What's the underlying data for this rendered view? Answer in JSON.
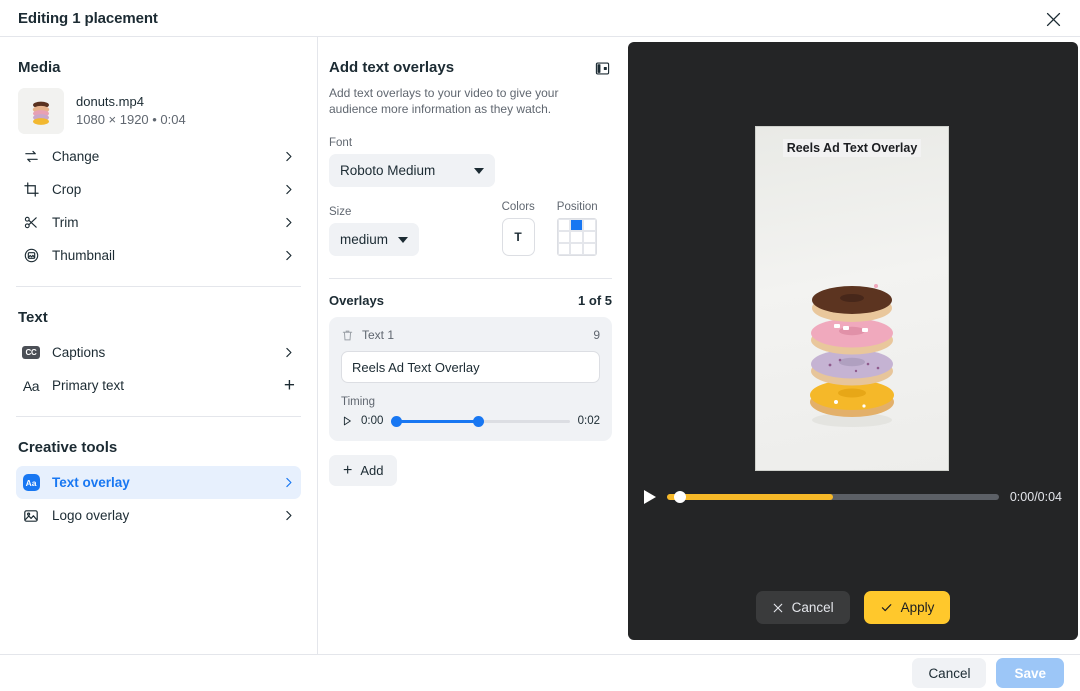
{
  "window": {
    "title": "Editing 1 placement",
    "close_icon": "close-icon"
  },
  "sidebar": {
    "sections": [
      {
        "title": "Media"
      },
      {
        "title": "Text"
      },
      {
        "title": "Creative tools"
      }
    ],
    "media": {
      "filename": "donuts.mp4",
      "meta": "1080 × 1920 • 0:04"
    },
    "media_items": [
      {
        "label": "Change",
        "icon": "swap-arrows-icon",
        "action": "chevron-right-icon"
      },
      {
        "label": "Crop",
        "icon": "crop-icon",
        "action": "chevron-right-icon"
      },
      {
        "label": "Trim",
        "icon": "scissors-icon",
        "action": "chevron-right-icon"
      },
      {
        "label": "Thumbnail",
        "icon": "thumbnail-icon",
        "action": "chevron-right-icon"
      }
    ],
    "text_items": [
      {
        "label": "Captions",
        "icon": "cc-icon",
        "action": "chevron-right-icon"
      },
      {
        "label": "Primary text",
        "icon": "aa-icon",
        "action": "plus-icon"
      }
    ],
    "creative_items": [
      {
        "label": "Text overlay",
        "icon": "aa-badge-icon",
        "action": "chevron-right-icon",
        "active": true
      },
      {
        "label": "Logo overlay",
        "icon": "image-icon",
        "action": "chevron-right-icon",
        "active": false
      }
    ]
  },
  "middle": {
    "title": "Add text overlays",
    "panel_toggle_icon": "panel-layout-icon",
    "description": "Add text overlays to your video to give your audience more information as they watch.",
    "font": {
      "label": "Font",
      "value": "Roboto Medium"
    },
    "size": {
      "label": "Size",
      "value": "medium"
    },
    "colors": {
      "label": "Colors",
      "swatch_glyph": "T"
    },
    "position": {
      "label": "Position",
      "selected_index": 1,
      "accent": "#1877f2"
    },
    "overlays": {
      "label": "Overlays",
      "count_label": "1 of 5",
      "items": [
        {
          "name": "Text 1",
          "char_count": "9",
          "value": "Reels Ad Text Overlay",
          "delete_icon": "trash-icon",
          "timing": {
            "label": "Timing",
            "play_icon": "play-outline-icon",
            "start": "0:00",
            "end": "0:02",
            "start_pct": 2,
            "end_pct": 48
          }
        }
      ],
      "add_label": "Add",
      "add_icon": "plus-icon"
    }
  },
  "preview": {
    "overlay_text": "Reels Ad Text Overlay",
    "player": {
      "play_icon": "play-icon",
      "time": "0:00/0:04",
      "progress_pct": 50,
      "thumb_pct": 2,
      "accent": "#f7b928"
    },
    "actions": {
      "cancel_label": "Cancel",
      "cancel_icon": "x-icon",
      "apply_label": "Apply",
      "apply_icon": "check-icon"
    }
  },
  "footer": {
    "cancel_label": "Cancel",
    "save_label": "Save"
  }
}
